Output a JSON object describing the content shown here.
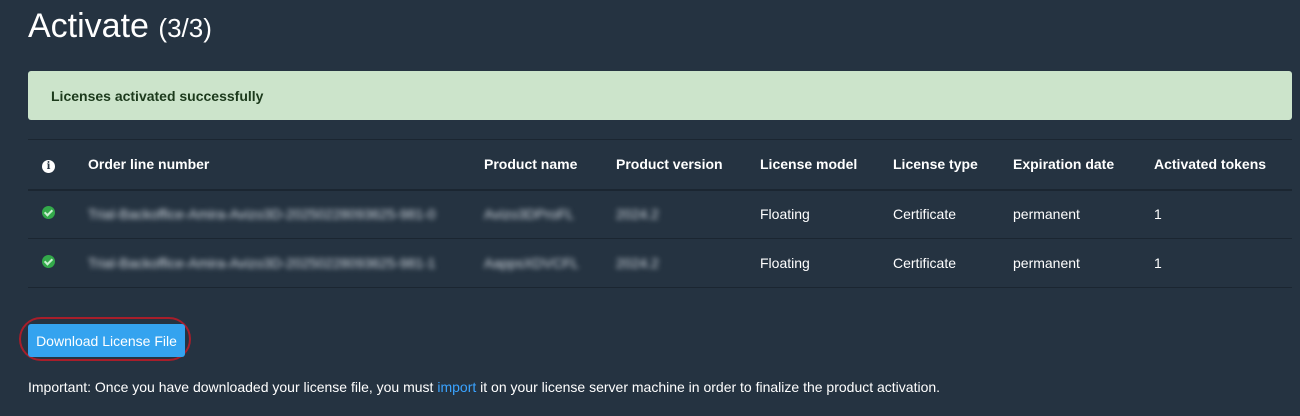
{
  "header": {
    "title": "Activate",
    "step": "(3/3)"
  },
  "alert": {
    "message": "Licenses activated successfully"
  },
  "table": {
    "columns": [
      "Order line number",
      "Product name",
      "Product version",
      "License model",
      "License type",
      "Expiration date",
      "Activated tokens"
    ],
    "rows": [
      {
        "order_line": "Trial-Backoffice-Amira-Avizo3D-20250228093625-981-0",
        "product_name": "Avizo3DProFL",
        "product_version": "2024.2",
        "license_model": "Floating",
        "license_type": "Certificate",
        "expiration_date": "permanent",
        "activated_tokens": "1"
      },
      {
        "order_line": "Trial-Backoffice-Amira-Avizo3D-20250228093625-981-1",
        "product_name": "AappsXDVCFL",
        "product_version": "2024.2",
        "license_model": "Floating",
        "license_type": "Certificate",
        "expiration_date": "permanent",
        "activated_tokens": "1"
      }
    ]
  },
  "download_button": {
    "label": "Download License File"
  },
  "note": {
    "before": "Important: Once you have downloaded your license file, you must ",
    "link": "import",
    "after": " it on your license server machine in order to finalize the product activation."
  },
  "colors": {
    "background": "#253341",
    "success_bg": "#cce4cb",
    "button": "#34a3ef",
    "link": "#3aa3ff",
    "check": "#33a94a",
    "highlight_ring": "#a81e2a"
  }
}
